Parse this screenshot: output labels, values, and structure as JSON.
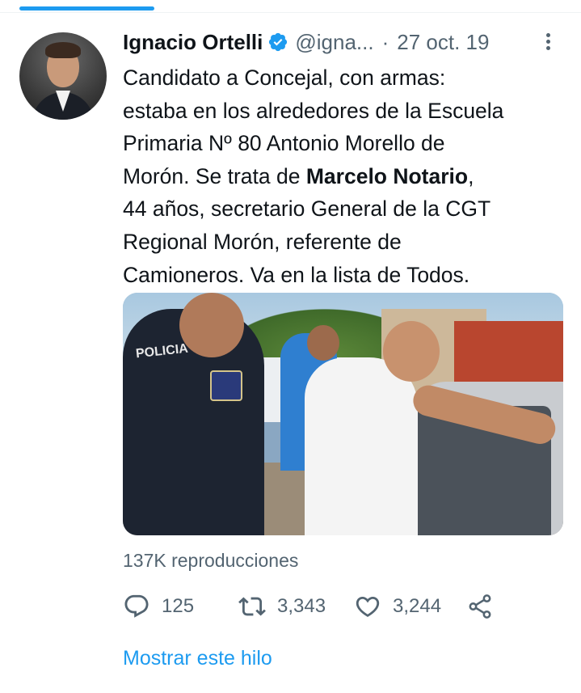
{
  "tweet": {
    "author_name": "Ignacio Ortelli",
    "handle": "@igna...",
    "separator": "·",
    "date": "27 oct. 19",
    "text_lines": {
      "line1": "Candidato a Concejal, con armas:",
      "line2": "estaba en los alrededores de la Escuela",
      "line3": "Primaria Nº 80 Antonio Morello de",
      "line4_pre": "Morón. Se trata de ",
      "line4_bold": "Marcelo Notario",
      "line4_post": ",",
      "line5": "44 años, secretario General de la CGT",
      "line6": "Regional Morón, referente de",
      "line7": "Camioneros. Va en la lista de Todos."
    },
    "media": {
      "vest_text": "POLICIA"
    },
    "views": "137K reproducciones",
    "replies": "125",
    "retweets": "3,343",
    "likes": "3,244",
    "show_thread": "Mostrar este hilo"
  },
  "colors": {
    "accent": "#1d9bf0",
    "secondary_text": "#536471",
    "primary_text": "#0f1419"
  },
  "icons": [
    "verified-badge-icon",
    "more-icon",
    "reply-icon",
    "retweet-icon",
    "like-icon",
    "share-icon"
  ]
}
